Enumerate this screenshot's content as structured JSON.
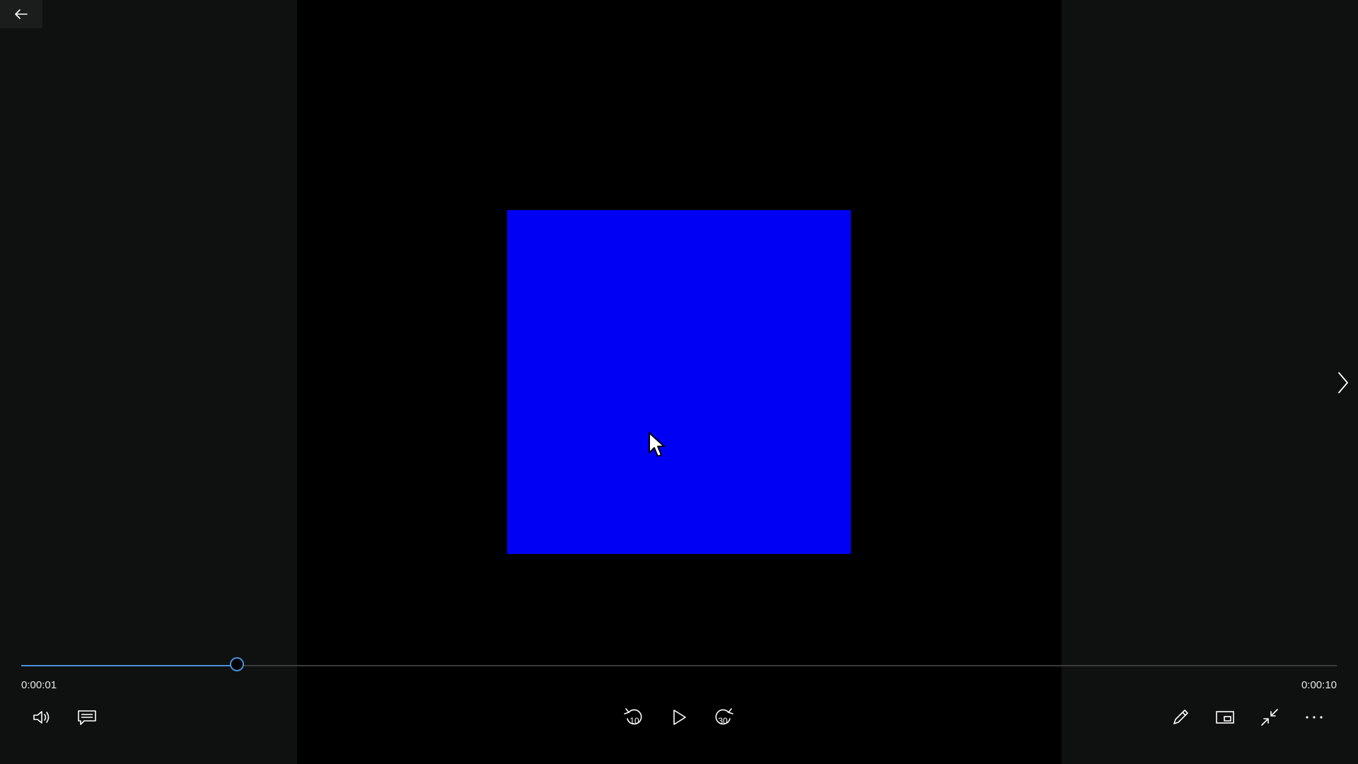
{
  "player": {
    "elapsed_time": "0:00:01",
    "total_time": "0:00:10",
    "progress_fraction": 0.164,
    "frame_color": "#0000f4",
    "accent_color": "#4a90d9"
  },
  "controls": {
    "back": "back-arrow-icon",
    "next": "chevron-right-icon",
    "volume": "volume-icon",
    "captions": "captions-icon",
    "skip_back": "skip-back-10-icon",
    "skip_back_label": "10",
    "play": "play-icon",
    "skip_forward": "skip-forward-30-icon",
    "skip_forward_label": "30",
    "edit": "pencil-icon",
    "mini_view": "mini-view-icon",
    "exit_fullscreen": "exit-fullscreen-icon",
    "more": "more-icon"
  }
}
